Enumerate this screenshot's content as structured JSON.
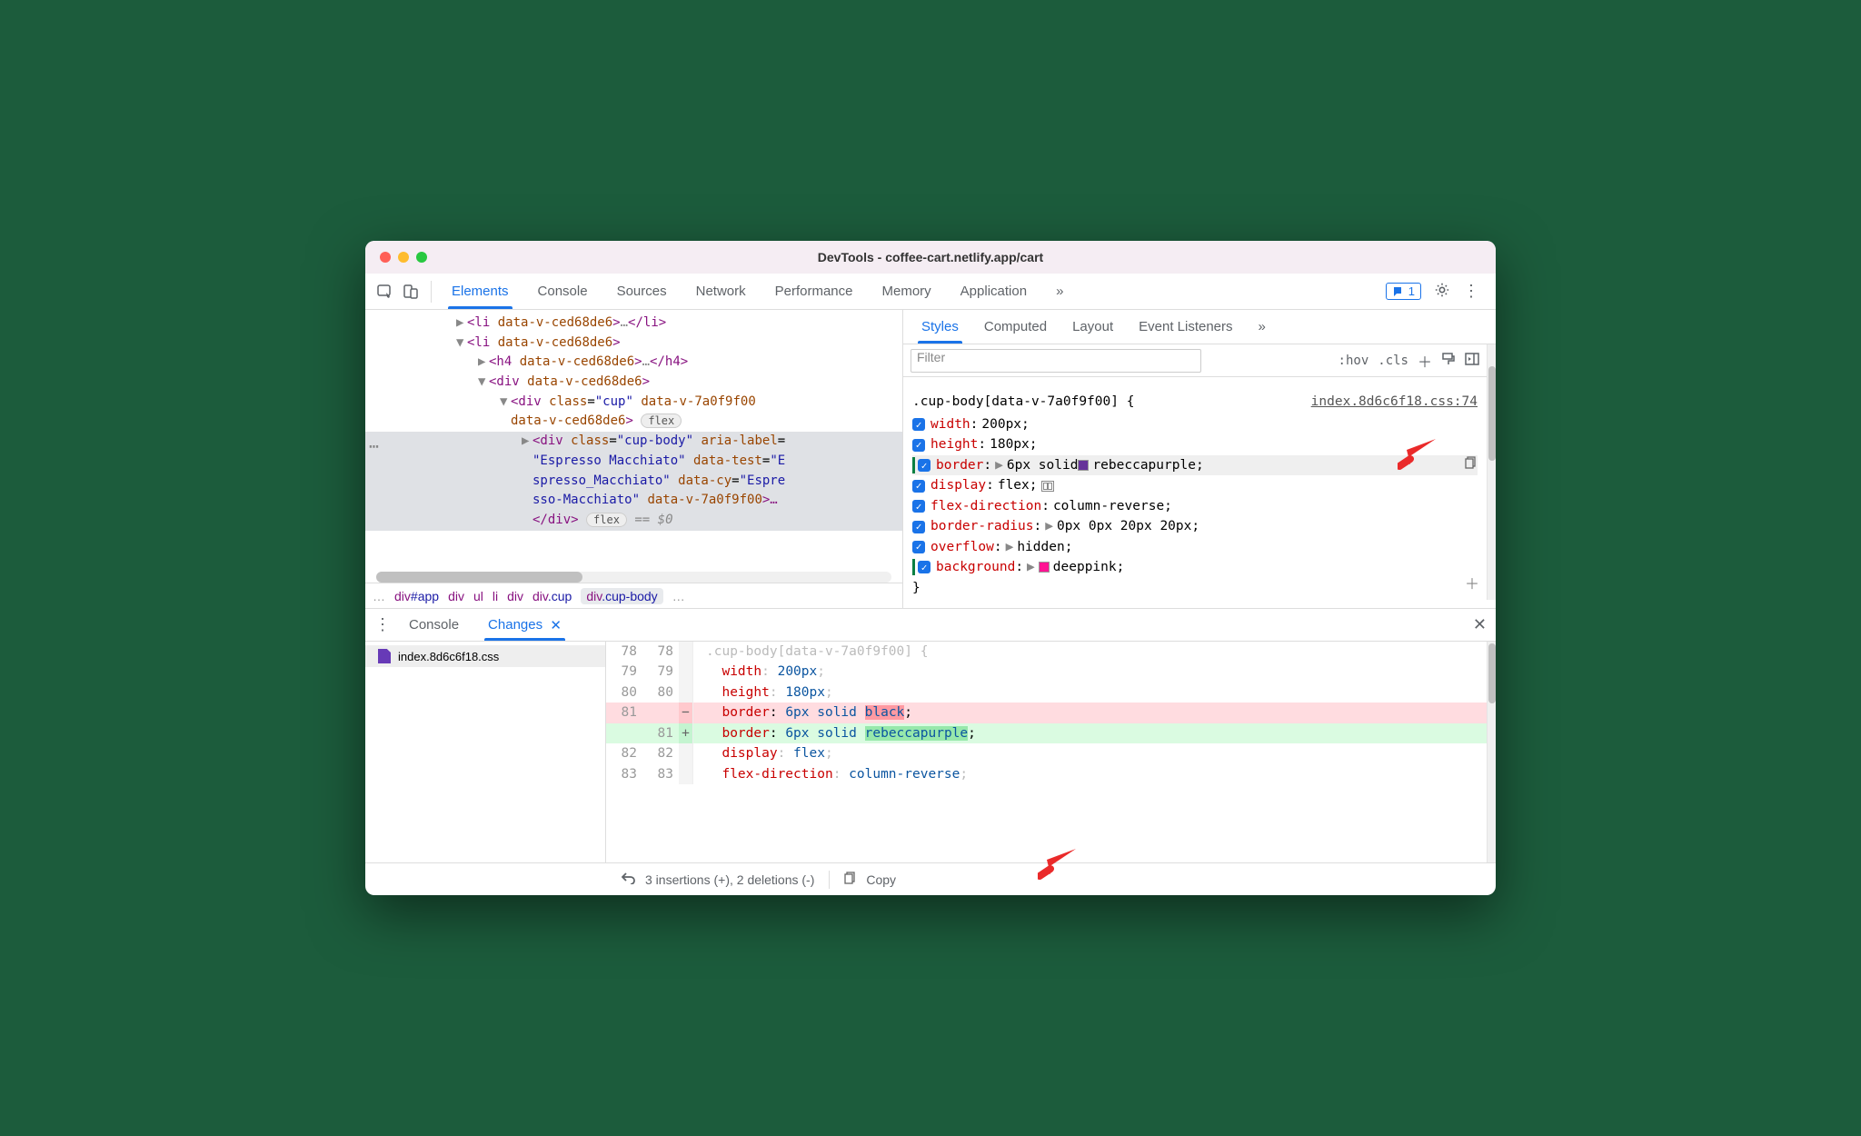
{
  "title": "DevTools - coffee-cart.netlify.app/cart",
  "main_tabs": [
    "Elements",
    "Console",
    "Sources",
    "Network",
    "Performance",
    "Memory",
    "Application"
  ],
  "issues_count": "1",
  "dom": {
    "l1": {
      "open": "<li",
      "attr": " data-v-ced68de6",
      "close1": ">",
      "dots": "…",
      "close2": "</li>"
    },
    "l2": {
      "open": "<li",
      "attr": " data-v-ced68de6",
      "close": ">"
    },
    "l3": {
      "open": "<h4",
      "attr": " data-v-ced68de6",
      "close1": ">",
      "dots": "…",
      "close2": "</h4>"
    },
    "l4": {
      "open": "<div",
      "attr": " data-v-ced68de6",
      "close": ">"
    },
    "l5": {
      "open": "<div ",
      "cls": "class",
      "eq": "=",
      "clsv": "\"cup\"",
      "attr": " data-v-7a0f9f00",
      "attr2": "data-v-ced68de6",
      "close": ">",
      "flex": "flex"
    },
    "l6a": "<div ",
    "l6cls": "class",
    "l6eq": "=",
    "l6clsv": "\"cup-body\"",
    "l6ar": " aria-label",
    "l6arv": "\"Espresso Macchiato\"",
    "l6dt": " data-test",
    "l6dtv": "\"Espresso_Macchiato\"",
    "l6dc": " data-cy",
    "l6dcv": "\"Espresso-Macchiato\"",
    "l6dv": " data-v-7a0f9f00",
    "l6close": ">…",
    "l7": "</div>",
    "l7flex": "flex",
    "l7eq": " == $0"
  },
  "crumbs": {
    "app": "div#app",
    "div": "div",
    "ul": "ul",
    "li": "li",
    "div2": "div",
    "cup": "div.cup",
    "cupbody": "div.cup-body"
  },
  "styles_tabs": [
    "Styles",
    "Computed",
    "Layout",
    "Event Listeners"
  ],
  "filter_placeholder": "Filter",
  "hov": ":hov",
  "cls": ".cls",
  "rule": {
    "selector": ".cup-body[data-v-7a0f9f00] {",
    "source": "index.8d6c6f18.css:74",
    "props": [
      {
        "name": "width",
        "value": "200px",
        "expand": false,
        "green": false
      },
      {
        "name": "height",
        "value": "180px",
        "expand": false,
        "green": false
      },
      {
        "name": "border",
        "value": "6px solid",
        "expand": true,
        "swatch": "purple",
        "swatchval": "rebeccapurple",
        "hl": true,
        "green": true,
        "copy": true
      },
      {
        "name": "display",
        "value": "flex",
        "expand": false,
        "flexicon": true,
        "green": false
      },
      {
        "name": "flex-direction",
        "value": "column-reverse",
        "expand": false,
        "green": false
      },
      {
        "name": "border-radius",
        "value": "0px 0px 20px 20px",
        "expand": true,
        "green": false
      },
      {
        "name": "overflow",
        "value": "hidden",
        "expand": true,
        "green": false
      },
      {
        "name": "background",
        "value": "",
        "expand": true,
        "swatch": "pink",
        "swatchval": "deeppink",
        "green": true
      }
    ],
    "closer": "}"
  },
  "drawer_tabs": [
    "Console",
    "Changes"
  ],
  "file_name": "index.8d6c6f18.css",
  "diff": {
    "sel": ".cup-body[data-v-7a0f9f00] {",
    "l78": {
      "old": "78",
      "new": "78",
      "name": "",
      "val": ""
    },
    "l79": {
      "old": "79",
      "new": "79",
      "name": "width",
      "val": "200px"
    },
    "l80": {
      "old": "80",
      "new": "80",
      "name": "height",
      "val": "180px"
    },
    "del": {
      "old": "81",
      "new": "",
      "name": "border",
      "pre": "6px solid ",
      "word": "black"
    },
    "add": {
      "old": "",
      "new": "81",
      "name": "border",
      "pre": "6px solid ",
      "word": "rebeccapurple"
    },
    "l82": {
      "old": "82",
      "new": "82",
      "name": "display",
      "val": "flex"
    },
    "l83": {
      "old": "83",
      "new": "83",
      "name": "flex-direction",
      "val": "column-reverse"
    }
  },
  "footer": {
    "summary": "3 insertions (+), 2 deletions (-)",
    "copy": "Copy"
  }
}
